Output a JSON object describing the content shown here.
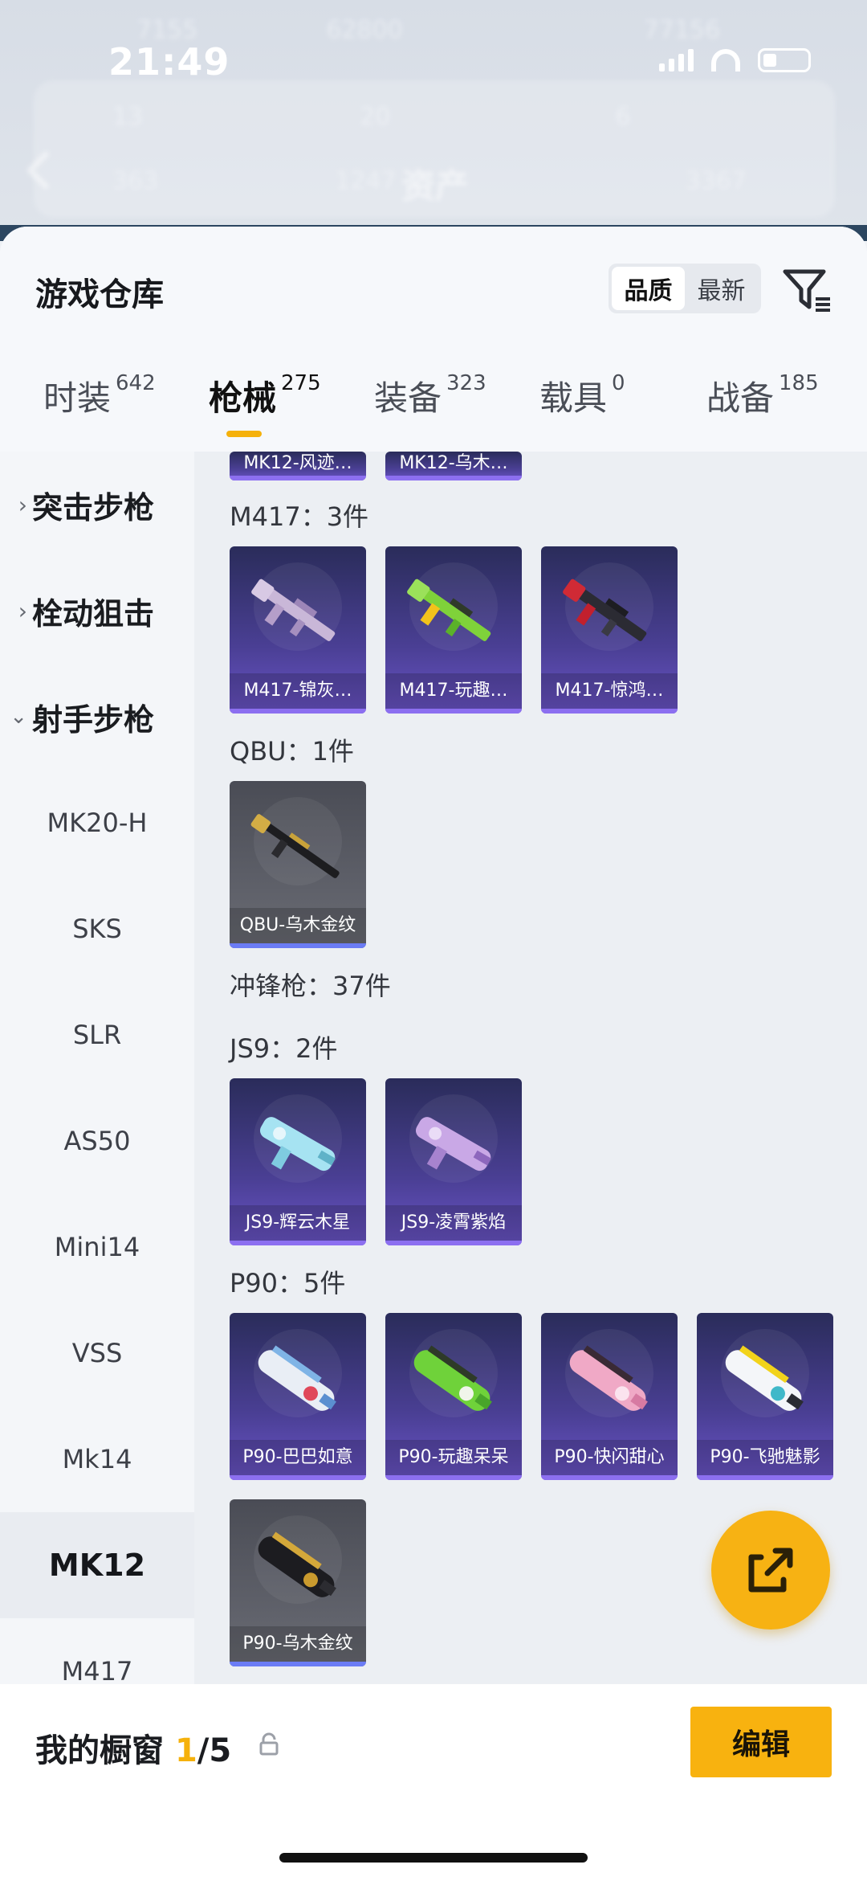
{
  "status_bar": {
    "time": "21:49"
  },
  "background": {
    "title": "资产",
    "row1": [
      "7155",
      "62800",
      "77156"
    ],
    "row2": [
      "13",
      "20",
      "6"
    ],
    "row3": [
      "363",
      "1247",
      "3367"
    ]
  },
  "sheet": {
    "title": "游戏仓库",
    "sort_options": [
      "品质",
      "最新"
    ],
    "active_sort": "品质"
  },
  "tabs": [
    {
      "label": "时装",
      "count": "642"
    },
    {
      "label": "枪械",
      "count": "275",
      "active": true
    },
    {
      "label": "装备",
      "count": "323"
    },
    {
      "label": "载具",
      "count": "0"
    },
    {
      "label": "战备",
      "count": "185"
    }
  ],
  "sidenav": {
    "categories": [
      {
        "label": "突击步枪",
        "expanded": false
      },
      {
        "label": "栓动狙击",
        "expanded": false
      },
      {
        "label": "射手步枪",
        "expanded": true
      }
    ],
    "subitems": [
      "MK20-H",
      "SKS",
      "SLR",
      "AS50",
      "Mini14",
      "VSS",
      "Mk14",
      "MK12",
      "M417"
    ],
    "active_subitem": "MK12"
  },
  "content": {
    "partial_cards": [
      "MK12-风迹…",
      "MK12-乌木…"
    ],
    "m417_label": "M417：3件",
    "m417_cards": [
      "M417-锦灰…",
      "M417-玩趣…",
      "M417-惊鸿…"
    ],
    "qbu_label": "QBU：1件",
    "qbu_cards": [
      "QBU-乌木金纹"
    ],
    "smg_label": "冲锋枪：37件",
    "js9_label": "JS9：2件",
    "js9_cards": [
      "JS9-辉云木星",
      "JS9-凌霄紫焰"
    ],
    "p90_label": "P90：5件",
    "p90_cards": [
      "P90-巴巴如意",
      "P90-玩趣呆呆",
      "P90-快闪甜心",
      "P90-飞驰魅影",
      "P90-乌木金纹"
    ]
  },
  "bottom": {
    "showcase_label": "我的橱窗",
    "showcase_used": "1",
    "showcase_total": "/5",
    "edit_label": "编辑"
  },
  "colors": {
    "accent": "#f5b10b",
    "card_purple": "#4a3f94",
    "card_grey": "#5d5f68"
  }
}
